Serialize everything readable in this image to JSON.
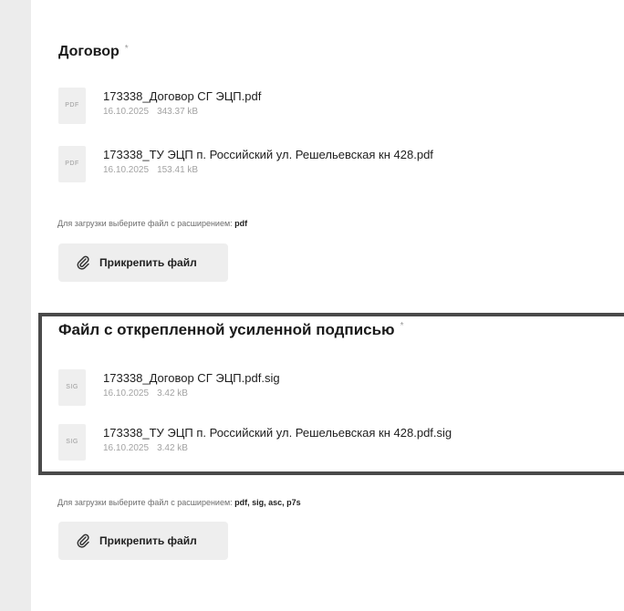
{
  "contract_section": {
    "title": "Договор",
    "required_mark": "*",
    "files": [
      {
        "type_label": "PDF",
        "name": "173338_Договор СГ ЭЦП.pdf",
        "date": "16.10.2025",
        "size": "343.37 kB"
      },
      {
        "type_label": "PDF",
        "name": "173338_ТУ ЭЦП п. Российский ул. Решельевская кн 428.pdf",
        "date": "16.10.2025",
        "size": "153.41 kB"
      }
    ],
    "hint_text": "Для загрузки выберите файл с расширением: ",
    "hint_ext": "pdf",
    "attach_label": "Прикрепить файл"
  },
  "signature_section": {
    "title": "Файл с открепленной усиленной подписью",
    "required_mark": "*",
    "files": [
      {
        "type_label": "SIG",
        "name": "173338_Договор СГ ЭЦП.pdf.sig",
        "date": "16.10.2025",
        "size": "3.42 kB"
      },
      {
        "type_label": "SIG",
        "name": "173338_ТУ ЭЦП п. Российский ул. Решельевская кн 428.pdf.sig",
        "date": "16.10.2025",
        "size": "3.42 kB"
      }
    ],
    "hint_text": "Для загрузки выберите файл с расширением: ",
    "hint_ext": "pdf, sig, asc, p7s",
    "attach_label": "Прикрепить файл"
  },
  "icons": {
    "paperclip": "paperclip-icon",
    "file": "file-icon"
  }
}
